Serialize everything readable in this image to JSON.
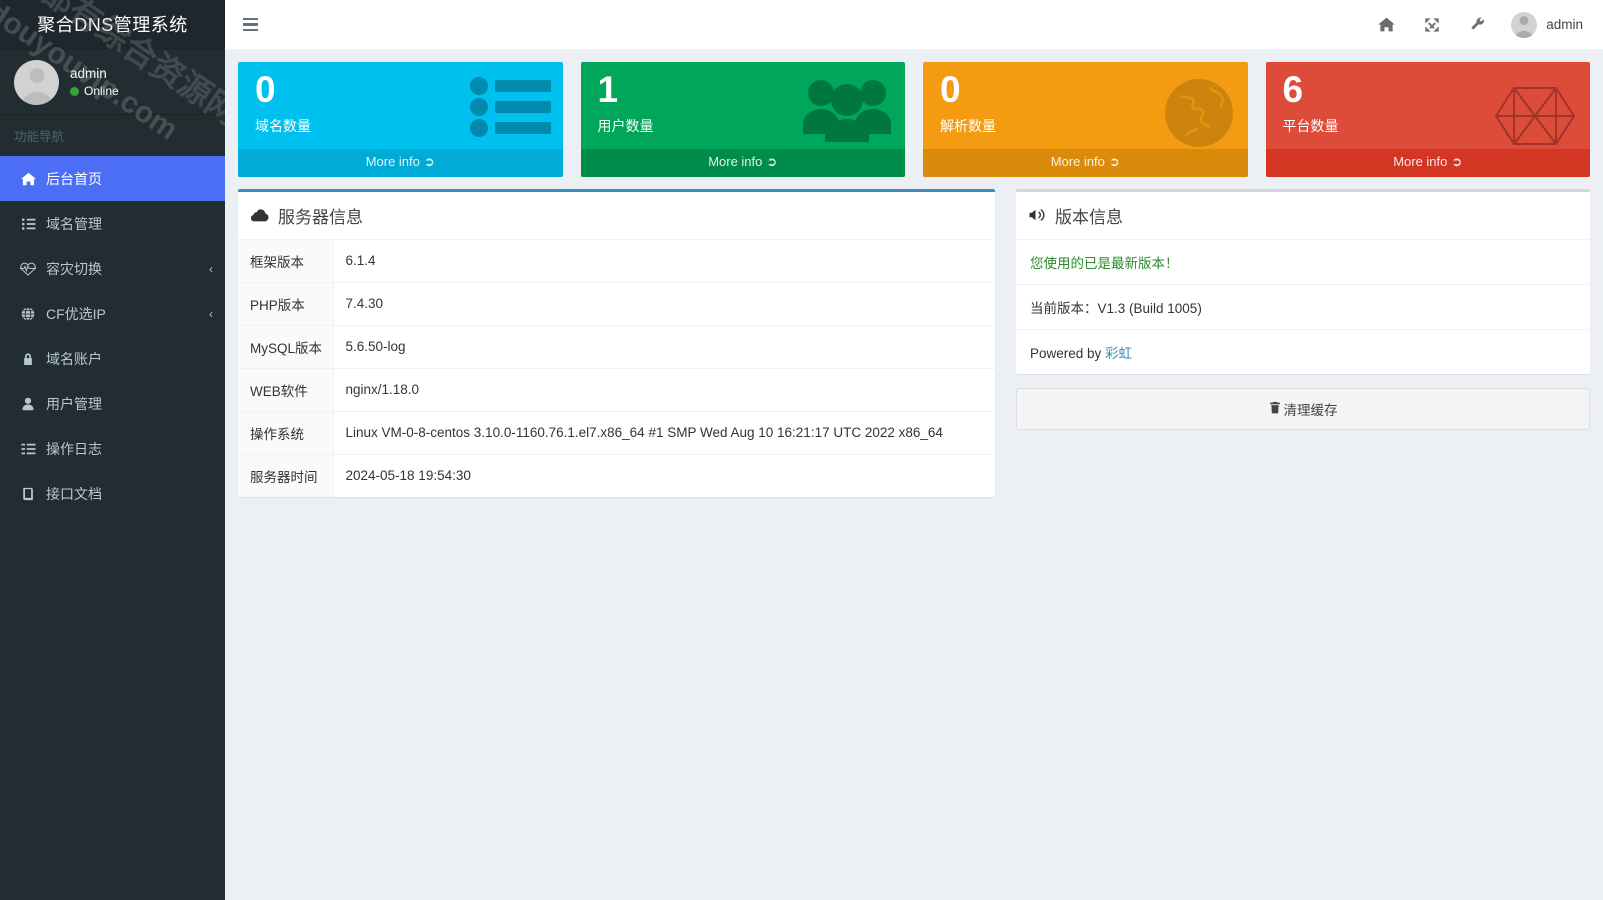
{
  "sidebar": {
    "logo": "聚合DNS管理系统",
    "user": {
      "name": "admin",
      "status": "Online"
    },
    "nav_header": "功能导航",
    "items": [
      {
        "label": "后台首页",
        "icon": "home-icon",
        "active": true,
        "chevron": ""
      },
      {
        "label": "域名管理",
        "icon": "list-ul-icon",
        "active": false,
        "chevron": ""
      },
      {
        "label": "容灾切换",
        "icon": "heartbeat-icon",
        "active": false,
        "chevron": "‹"
      },
      {
        "label": "CF优选IP",
        "icon": "globe-icon",
        "active": false,
        "chevron": "‹"
      },
      {
        "label": "域名账户",
        "icon": "lock-icon",
        "active": false,
        "chevron": ""
      },
      {
        "label": "用户管理",
        "icon": "user-icon",
        "active": false,
        "chevron": ""
      },
      {
        "label": "操作日志",
        "icon": "list-icon",
        "active": false,
        "chevron": ""
      },
      {
        "label": "接口文档",
        "icon": "book-icon",
        "active": false,
        "chevron": ""
      }
    ],
    "watermark_line1": "兔都有综合资源网",
    "watermark_line2": "douyouvip.com"
  },
  "topbar": {
    "menu_toggle": "bars-icon",
    "icons": [
      "home-icon",
      "expand-icon",
      "wrench-icon"
    ],
    "user_name": "admin"
  },
  "stats": [
    {
      "value": "0",
      "label": "域名数量",
      "more": "More info",
      "color": "#00c0ef",
      "footer_color": "#00acd6",
      "art": "list-icon"
    },
    {
      "value": "1",
      "label": "用户数量",
      "more": "More info",
      "color": "#00a65a",
      "footer_color": "#008d4c",
      "art": "users-icon"
    },
    {
      "value": "0",
      "label": "解析数量",
      "more": "More info",
      "color": "#f39c12",
      "footer_color": "#db8b0b",
      "art": "globe-icon"
    },
    {
      "value": "6",
      "label": "平台数量",
      "more": "More info",
      "color": "#dd4b39",
      "footer_color": "#d33724",
      "art": "sitemap-icon"
    }
  ],
  "server_info": {
    "title": "服务器信息",
    "icon": "cloud-icon",
    "rows": [
      {
        "key": "框架版本",
        "value": "6.1.4"
      },
      {
        "key": "PHP版本",
        "value": "7.4.30"
      },
      {
        "key": "MySQL版本",
        "value": "5.6.50-log"
      },
      {
        "key": "WEB软件",
        "value": "nginx/1.18.0"
      },
      {
        "key": "操作系统",
        "value": "Linux VM-0-8-centos 3.10.0-1160.76.1.el7.x86_64 #1 SMP Wed Aug 10 16:21:17 UTC 2022 x86_64"
      },
      {
        "key": "服务器时间",
        "value": "2024-05-18 19:54:30"
      }
    ]
  },
  "version_info": {
    "title": "版本信息",
    "icon": "bullhorn-icon",
    "status_text": "您使用的已是最新版本！",
    "current_version": "当前版本：V1.3 (Build 1005)",
    "powered_by_prefix": "Powered by ",
    "powered_by_link": "彩虹",
    "clear_cache_button": "清理缓存",
    "clear_cache_icon": "trash-icon"
  },
  "colors": {
    "sidebar_bg": "#222d32",
    "active_nav": "#4c6ef5",
    "primary_border": "#3c8dbc",
    "content_bg": "#ecf0f5",
    "success_text": "#2e8b2e"
  }
}
